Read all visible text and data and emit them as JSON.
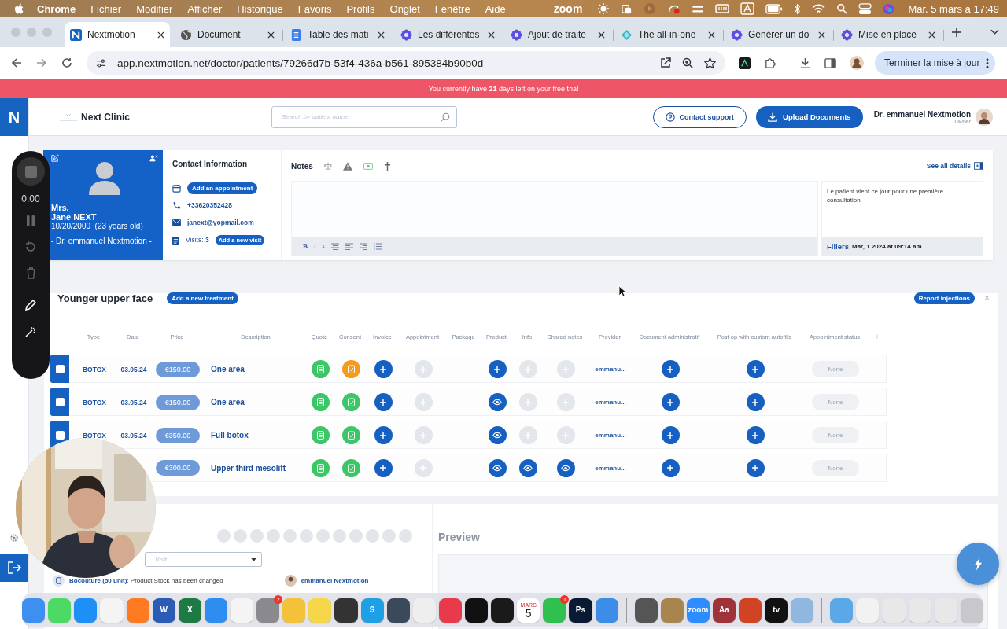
{
  "menubar": {
    "app": "Chrome",
    "menus": [
      "Fichier",
      "Modifier",
      "Afficher",
      "Historique",
      "Favoris",
      "Profils",
      "Onglet",
      "Fenêtre",
      "Aide"
    ],
    "zoom": "zoom",
    "clock": "Mar. 5 mars à 17:49"
  },
  "tabs": [
    {
      "title": "Nextmotion",
      "selected": true,
      "kind": "logo"
    },
    {
      "title": "Document",
      "selected": false,
      "kind": "globe"
    },
    {
      "title": "Table des mati",
      "selected": false,
      "kind": "doc"
    },
    {
      "title": "Les différentes",
      "selected": false,
      "kind": "flower"
    },
    {
      "title": "Ajout de traite",
      "selected": false,
      "kind": "flower"
    },
    {
      "title": "The all-in-one",
      "selected": false,
      "kind": "diamond"
    },
    {
      "title": "Générer un do",
      "selected": false,
      "kind": "flower"
    },
    {
      "title": "Mise en place",
      "selected": false,
      "kind": "flower"
    }
  ],
  "address": {
    "url": "app.nextmotion.net/doctor/patients/79266d7b-53f4-436a-b561-895384b90b0d",
    "update_button": "Terminer la mise à jour"
  },
  "banner": "You currently have **21** days left on your free trial",
  "header": {
    "logo": "N",
    "clinic": "Next Clinic",
    "search_placeholder": "Search by patient name",
    "contact": "Contact support",
    "upload": "Upload Documents",
    "user": "Dr. emmanuel Nextmotion",
    "role": "Owner"
  },
  "recorder": {
    "time": "0:00"
  },
  "patient": {
    "title": "Mrs.",
    "name": "Jane NEXT",
    "dob": "10/20/2000  (23 years old)",
    "doctor": "- Dr. emmanuel Nextmotion -"
  },
  "contact": {
    "heading": "Contact Information",
    "appointment_button": "Add an appointment",
    "phone": "+33620352428",
    "email": "janext@yopmail.com",
    "visits": "Visits: **3**",
    "visit_button": "Add a new visit"
  },
  "notes": {
    "heading": "Notes",
    "details_link": "See all details",
    "format_buttons": [
      "B",
      "i",
      "s"
    ],
    "note_text": "Le patient vient ce jour pour une première consultation",
    "note_category": "Fillers",
    "note_date": "Mar, 1 2024 at 09:14 am"
  },
  "treatment": {
    "title": "Younger upper face",
    "add_button": "Add a new treatment",
    "report_button": "Report injections",
    "close": "×",
    "add_column": "+",
    "columns": [
      "Type",
      "Date",
      "Price",
      "Description",
      "Quote",
      "Consent",
      "Invoice",
      "Appointment",
      "Package",
      "Product",
      "Info",
      "Shared notes",
      "Provider",
      "Document administratif",
      "Post op with custom autofills",
      "Appointment status"
    ],
    "rows": [
      {
        "checked": false,
        "type": "BOTOX",
        "date": "03.05.24",
        "price": "€150.00",
        "description": "One area",
        "consent": {
          "color": "#f29b1d"
        },
        "invoice": {
          "kind": "add",
          "disabled": false
        },
        "appointment": {
          "kind": "add",
          "disabled": true
        },
        "product": {
          "kind": "add",
          "disabled": false
        },
        "info": {
          "kind": "add",
          "disabled": true
        },
        "shared_notes": {
          "kind": "add",
          "disabled": true
        },
        "provider": "emmanu...",
        "document": {
          "kind": "add",
          "disabled": false
        },
        "post_op": {
          "kind": "add",
          "disabled": false
        },
        "status": "None"
      },
      {
        "checked": false,
        "type": "BOTOX",
        "date": "03.05.24",
        "price": "€150.00",
        "description": "One area",
        "consent": {
          "color": "#3cc766"
        },
        "invoice": {
          "kind": "add",
          "disabled": false
        },
        "appointment": {
          "kind": "add",
          "disabled": true
        },
        "product": {
          "kind": "view",
          "disabled": false
        },
        "info": {
          "kind": "add",
          "disabled": true
        },
        "shared_notes": {
          "kind": "add",
          "disabled": true
        },
        "provider": "emmanu...",
        "document": {
          "kind": "add",
          "disabled": false
        },
        "post_op": {
          "kind": "add",
          "disabled": false
        },
        "status": "None"
      },
      {
        "checked": false,
        "type": "BOTOX",
        "date": "03.05.24",
        "price": "€350.00",
        "description": "Full botox",
        "consent": {
          "color": "#3cc766"
        },
        "invoice": {
          "kind": "add",
          "disabled": false
        },
        "appointment": {
          "kind": "add",
          "disabled": true
        },
        "product": {
          "kind": "view",
          "disabled": false
        },
        "info": {
          "kind": "add",
          "disabled": true
        },
        "shared_notes": {
          "kind": "add",
          "disabled": true
        },
        "provider": "emmanu...",
        "document": {
          "kind": "add",
          "disabled": false
        },
        "post_op": {
          "kind": "add",
          "disabled": false
        },
        "status": "None"
      },
      {
        "price": "€300.00",
        "description": "Upper third mesolift",
        "consent": {
          "color": "#3cc766"
        },
        "invoice": {
          "kind": "add",
          "disabled": false
        },
        "appointment": {
          "kind": "add",
          "disabled": true
        },
        "product": {
          "kind": "view",
          "disabled": false
        },
        "info": {
          "kind": "view",
          "disabled": false
        },
        "shared_notes": {
          "kind": "view",
          "disabled": false
        },
        "provider": "emmanu...",
        "document": {
          "kind": "add",
          "disabled": false
        },
        "post_op": {
          "kind": "add",
          "disabled": false
        },
        "status": "None"
      }
    ]
  },
  "bottom": {
    "visit_placeholder": "Visit",
    "preview": "Preview",
    "activity": "**Bocouture (50 unit)**: Product Stock has been changed",
    "activity_user": "emmanuel Nextmotion"
  },
  "dock": [
    [
      {
        "color": "#3d8ff0"
      },
      {
        "color": "#4cd964"
      },
      {
        "color": "#1e8ff5"
      },
      {
        "color": "#f4f4f4"
      },
      {
        "color": "#ff7a20"
      },
      {
        "color": "#2b5bb5",
        "label": "W"
      },
      {
        "color": "#1d7a45",
        "label": "X"
      },
      {
        "color": "#2d8ef0"
      },
      {
        "color": "#f4f4f4"
      },
      {
        "color": "#8a8a8e",
        "badge": "2"
      },
      {
        "color": "#f3c13a"
      },
      {
        "color": "#f7d74a"
      },
      {
        "color": "#333333"
      },
      {
        "color": "#1ea0e6",
        "label": "S"
      },
      {
        "color": "#3a4a5c"
      },
      {
        "color": "#eeeeee"
      },
      {
        "color": "#e83a4a"
      },
      {
        "color": "#111111"
      },
      {
        "color": "#1a1a1a"
      },
      {
        "color": "#ffffff",
        "month": "MARS",
        "label": "5"
      },
      {
        "color": "#30c04f",
        "badge": "1"
      },
      {
        "color": "#0a1a33",
        "label": "Ps"
      },
      {
        "color": "#3b8de8"
      }
    ],
    [
      {
        "color": "#555555"
      },
      {
        "color": "#a8844e"
      },
      {
        "color": "#2d8cff",
        "label": "zoom"
      },
      {
        "color": "#a0323a",
        "label": "Aa"
      },
      {
        "color": "#d04423"
      },
      {
        "color": "#111111",
        "label": "tv"
      },
      {
        "color": "#8fb7e0"
      }
    ],
    [
      {
        "color": "#5aa9e6"
      },
      {
        "color": "#f2f2f2"
      },
      {
        "color": "#e8e8e8"
      },
      {
        "color": "#e8e8e8"
      },
      {
        "color": "#e8e8e8"
      },
      {
        "color": "#c8c8cc"
      }
    ]
  ]
}
